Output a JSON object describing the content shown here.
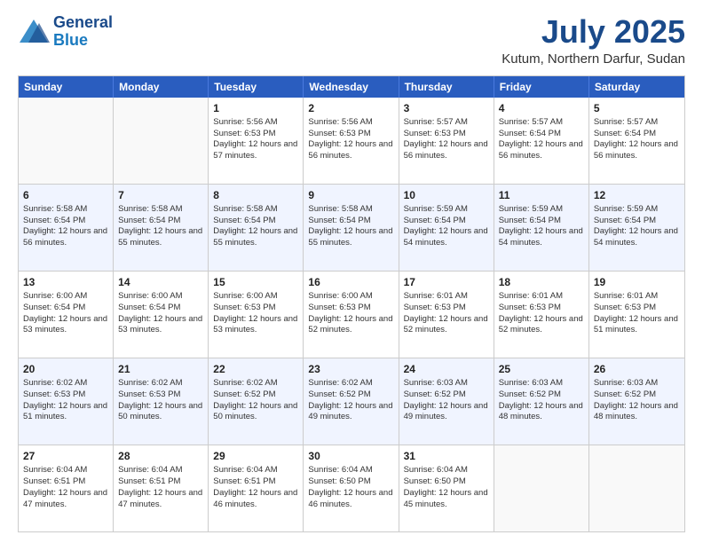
{
  "logo": {
    "line1": "General",
    "line2": "Blue"
  },
  "title": "July 2025",
  "subtitle": "Kutum, Northern Darfur, Sudan",
  "days": [
    "Sunday",
    "Monday",
    "Tuesday",
    "Wednesday",
    "Thursday",
    "Friday",
    "Saturday"
  ],
  "weeks": [
    [
      {
        "day": "",
        "empty": true
      },
      {
        "day": "",
        "empty": true
      },
      {
        "day": "1",
        "sun": "Sunrise: 5:56 AM",
        "set": "Sunset: 6:53 PM",
        "day_hours": "Daylight: 12 hours and 57 minutes."
      },
      {
        "day": "2",
        "sun": "Sunrise: 5:56 AM",
        "set": "Sunset: 6:53 PM",
        "day_hours": "Daylight: 12 hours and 56 minutes."
      },
      {
        "day": "3",
        "sun": "Sunrise: 5:57 AM",
        "set": "Sunset: 6:53 PM",
        "day_hours": "Daylight: 12 hours and 56 minutes."
      },
      {
        "day": "4",
        "sun": "Sunrise: 5:57 AM",
        "set": "Sunset: 6:54 PM",
        "day_hours": "Daylight: 12 hours and 56 minutes."
      },
      {
        "day": "5",
        "sun": "Sunrise: 5:57 AM",
        "set": "Sunset: 6:54 PM",
        "day_hours": "Daylight: 12 hours and 56 minutes."
      }
    ],
    [
      {
        "day": "6",
        "sun": "Sunrise: 5:58 AM",
        "set": "Sunset: 6:54 PM",
        "day_hours": "Daylight: 12 hours and 56 minutes."
      },
      {
        "day": "7",
        "sun": "Sunrise: 5:58 AM",
        "set": "Sunset: 6:54 PM",
        "day_hours": "Daylight: 12 hours and 55 minutes."
      },
      {
        "day": "8",
        "sun": "Sunrise: 5:58 AM",
        "set": "Sunset: 6:54 PM",
        "day_hours": "Daylight: 12 hours and 55 minutes."
      },
      {
        "day": "9",
        "sun": "Sunrise: 5:58 AM",
        "set": "Sunset: 6:54 PM",
        "day_hours": "Daylight: 12 hours and 55 minutes."
      },
      {
        "day": "10",
        "sun": "Sunrise: 5:59 AM",
        "set": "Sunset: 6:54 PM",
        "day_hours": "Daylight: 12 hours and 54 minutes."
      },
      {
        "day": "11",
        "sun": "Sunrise: 5:59 AM",
        "set": "Sunset: 6:54 PM",
        "day_hours": "Daylight: 12 hours and 54 minutes."
      },
      {
        "day": "12",
        "sun": "Sunrise: 5:59 AM",
        "set": "Sunset: 6:54 PM",
        "day_hours": "Daylight: 12 hours and 54 minutes."
      }
    ],
    [
      {
        "day": "13",
        "sun": "Sunrise: 6:00 AM",
        "set": "Sunset: 6:54 PM",
        "day_hours": "Daylight: 12 hours and 53 minutes."
      },
      {
        "day": "14",
        "sun": "Sunrise: 6:00 AM",
        "set": "Sunset: 6:54 PM",
        "day_hours": "Daylight: 12 hours and 53 minutes."
      },
      {
        "day": "15",
        "sun": "Sunrise: 6:00 AM",
        "set": "Sunset: 6:53 PM",
        "day_hours": "Daylight: 12 hours and 53 minutes."
      },
      {
        "day": "16",
        "sun": "Sunrise: 6:00 AM",
        "set": "Sunset: 6:53 PM",
        "day_hours": "Daylight: 12 hours and 52 minutes."
      },
      {
        "day": "17",
        "sun": "Sunrise: 6:01 AM",
        "set": "Sunset: 6:53 PM",
        "day_hours": "Daylight: 12 hours and 52 minutes."
      },
      {
        "day": "18",
        "sun": "Sunrise: 6:01 AM",
        "set": "Sunset: 6:53 PM",
        "day_hours": "Daylight: 12 hours and 52 minutes."
      },
      {
        "day": "19",
        "sun": "Sunrise: 6:01 AM",
        "set": "Sunset: 6:53 PM",
        "day_hours": "Daylight: 12 hours and 51 minutes."
      }
    ],
    [
      {
        "day": "20",
        "sun": "Sunrise: 6:02 AM",
        "set": "Sunset: 6:53 PM",
        "day_hours": "Daylight: 12 hours and 51 minutes."
      },
      {
        "day": "21",
        "sun": "Sunrise: 6:02 AM",
        "set": "Sunset: 6:53 PM",
        "day_hours": "Daylight: 12 hours and 50 minutes."
      },
      {
        "day": "22",
        "sun": "Sunrise: 6:02 AM",
        "set": "Sunset: 6:52 PM",
        "day_hours": "Daylight: 12 hours and 50 minutes."
      },
      {
        "day": "23",
        "sun": "Sunrise: 6:02 AM",
        "set": "Sunset: 6:52 PM",
        "day_hours": "Daylight: 12 hours and 49 minutes."
      },
      {
        "day": "24",
        "sun": "Sunrise: 6:03 AM",
        "set": "Sunset: 6:52 PM",
        "day_hours": "Daylight: 12 hours and 49 minutes."
      },
      {
        "day": "25",
        "sun": "Sunrise: 6:03 AM",
        "set": "Sunset: 6:52 PM",
        "day_hours": "Daylight: 12 hours and 48 minutes."
      },
      {
        "day": "26",
        "sun": "Sunrise: 6:03 AM",
        "set": "Sunset: 6:52 PM",
        "day_hours": "Daylight: 12 hours and 48 minutes."
      }
    ],
    [
      {
        "day": "27",
        "sun": "Sunrise: 6:04 AM",
        "set": "Sunset: 6:51 PM",
        "day_hours": "Daylight: 12 hours and 47 minutes."
      },
      {
        "day": "28",
        "sun": "Sunrise: 6:04 AM",
        "set": "Sunset: 6:51 PM",
        "day_hours": "Daylight: 12 hours and 47 minutes."
      },
      {
        "day": "29",
        "sun": "Sunrise: 6:04 AM",
        "set": "Sunset: 6:51 PM",
        "day_hours": "Daylight: 12 hours and 46 minutes."
      },
      {
        "day": "30",
        "sun": "Sunrise: 6:04 AM",
        "set": "Sunset: 6:50 PM",
        "day_hours": "Daylight: 12 hours and 46 minutes."
      },
      {
        "day": "31",
        "sun": "Sunrise: 6:04 AM",
        "set": "Sunset: 6:50 PM",
        "day_hours": "Daylight: 12 hours and 45 minutes."
      },
      {
        "day": "",
        "empty": true
      },
      {
        "day": "",
        "empty": true
      }
    ]
  ]
}
